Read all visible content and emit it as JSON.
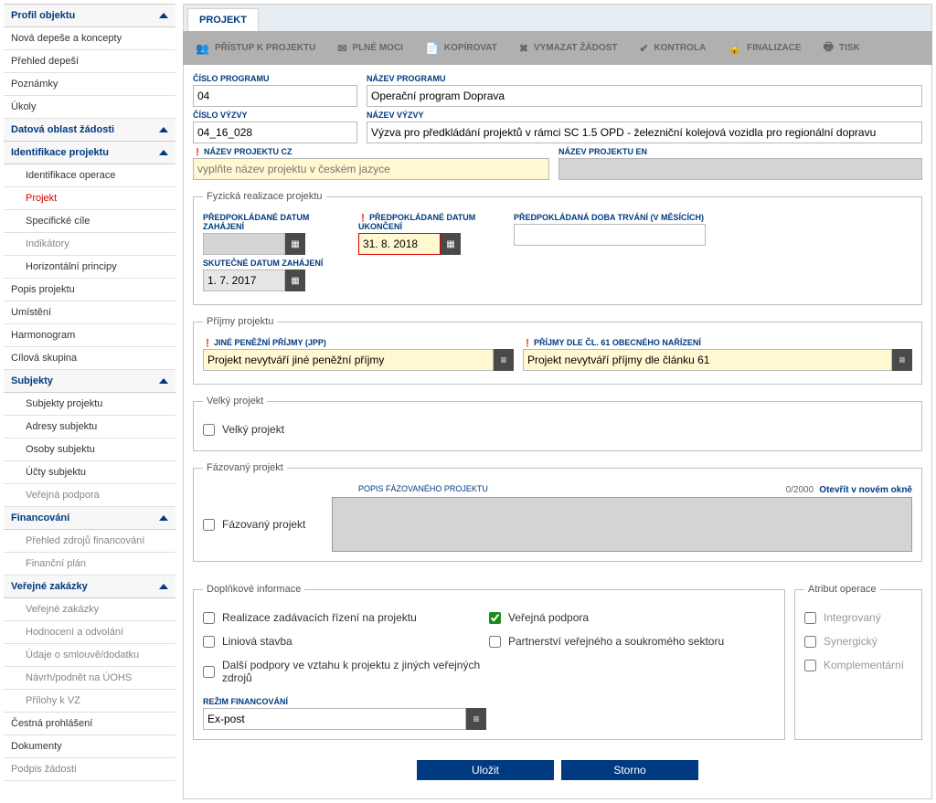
{
  "sidebar": {
    "groups": [
      {
        "label": "Profil objektu",
        "items": [
          {
            "label": "Nová depeše a koncepty"
          },
          {
            "label": "Přehled depeší"
          },
          {
            "label": "Poznámky"
          },
          {
            "label": "Úkoly"
          }
        ]
      },
      {
        "label": "Datová oblast žádosti",
        "items": []
      },
      {
        "label": "Identifikace projektu",
        "items": [
          {
            "label": "Identifikace operace",
            "sub": true
          },
          {
            "label": "Projekt",
            "sub": true,
            "active": true
          },
          {
            "label": "Specifické cíle",
            "sub": true
          },
          {
            "label": "Indikátory",
            "sub": true,
            "disabled": true
          },
          {
            "label": "Horizontální principy",
            "sub": true
          }
        ]
      },
      null,
      [
        {
          "label": "Popis projektu"
        },
        {
          "label": "Umístění"
        },
        {
          "label": "Harmonogram"
        },
        {
          "label": "Cílová skupina"
        }
      ],
      {
        "label": "Subjekty",
        "items": [
          {
            "label": "Subjekty projektu",
            "sub": true
          },
          {
            "label": "Adresy subjektu",
            "sub": true
          },
          {
            "label": "Osoby subjektu",
            "sub": true
          },
          {
            "label": "Účty subjektu",
            "sub": true
          },
          {
            "label": "Veřejná podpora",
            "sub": true,
            "disabled": true
          }
        ]
      },
      {
        "label": "Financování",
        "items": [
          {
            "label": "Přehled zdrojů financování",
            "sub": true,
            "disabled": true
          },
          {
            "label": "Finanční plán",
            "sub": true,
            "disabled": true
          }
        ]
      },
      {
        "label": "Veřejné zakázky",
        "items": [
          {
            "label": "Veřejné zakázky",
            "sub": true,
            "disabled": true
          },
          {
            "label": "Hodnocení a odvolání",
            "sub": true,
            "disabled": true
          },
          {
            "label": "Údaje o smlouvě/dodatku",
            "sub": true,
            "disabled": true
          },
          {
            "label": "Návrh/podnět na ÚOHS",
            "sub": true,
            "disabled": true
          },
          {
            "label": "Přílohy k VZ",
            "sub": true,
            "disabled": true
          }
        ]
      },
      null,
      [
        {
          "label": "Čestná prohlášení"
        },
        {
          "label": "Dokumenty"
        },
        {
          "label": "Podpis žádosti",
          "disabled": true
        }
      ]
    ]
  },
  "tabs": {
    "projekt": "PROJEKT"
  },
  "toolbar": {
    "pristup": "PŘÍSTUP K PROJEKTU",
    "plne_moci": "PLNÉ MOCI",
    "kopirovat": "KOPÍROVAT",
    "vymazat": "VYMAZAT ŽÁDOST",
    "kontrola": "KONTROLA",
    "finalizace": "FINALIZACE",
    "tisk": "TISK"
  },
  "fields": {
    "cislo_programu": {
      "label": "ČÍSLO PROGRAMU",
      "value": "04"
    },
    "nazev_programu": {
      "label": "NÁZEV PROGRAMU",
      "value": "Operační program Doprava"
    },
    "cislo_vyzvy": {
      "label": "ČÍSLO VÝZVY",
      "value": "04_16_028"
    },
    "nazev_vyzvy": {
      "label": "NÁZEV VÝZVY",
      "value": "Výzva pro předkládání projektů v rámci SC 1.5 OPD - železniční kolejová vozidla pro regionální dopravu"
    },
    "nazev_cz": {
      "label": "NÁZEV PROJEKTU CZ",
      "placeholder": "vyplňte název projektu v českém jazyce"
    },
    "nazev_en": {
      "label": "NÁZEV PROJEKTU EN"
    }
  },
  "fyzicka": {
    "legend": "Fyzická realizace projektu",
    "zahajeni": {
      "label": "PŘEDPOKLÁDANÉ DATUM ZAHÁJENÍ",
      "value": ""
    },
    "ukonceni": {
      "label": "PŘEDPOKLÁDANÉ DATUM UKONČENÍ",
      "value": "31. 8. 2018"
    },
    "trvani": {
      "label": "PŘEDPOKLÁDANÁ DOBA TRVÁNÍ (V MĚSÍCÍCH)",
      "value": ""
    },
    "skutecne": {
      "label": "SKUTEČNÉ DATUM ZAHÁJENÍ",
      "value": "1. 7. 2017"
    }
  },
  "prijmy": {
    "legend": "Příjmy projektu",
    "jpp": {
      "label": "JINÉ PENĚŽNÍ PŘÍJMY (JPP)",
      "value": "Projekt nevytváří jiné peněžní příjmy"
    },
    "cl61": {
      "label": "PŘÍJMY DLE ČL. 61 OBECNÉHO NAŘÍZENÍ",
      "value": "Projekt nevytváří příjmy dle článku 61"
    }
  },
  "velky": {
    "legend": "Velký projekt",
    "chk": "Velký projekt"
  },
  "fazovany": {
    "legend": "Fázovaný projekt",
    "chk": "Fázovaný projekt",
    "popis_label": "POPIS FÁZOVANÉHO PROJEKTU",
    "counter": "0/2000",
    "open": "Otevřít v novém okně"
  },
  "doplnkove": {
    "legend": "Doplňkové informace",
    "realizace": "Realizace zadávacích řízení na projektu",
    "verejna": "Veřejná podpora",
    "liniova": "Liniová stavba",
    "partnerstvi": "Partnerství veřejného a soukromého sektoru",
    "dalsi": "Další podpory ve vztahu k projektu z jiných veřejných zdrojů",
    "rezim_label": "REŽIM FINANCOVÁNÍ",
    "rezim_value": "Ex-post"
  },
  "atribut": {
    "legend": "Atribut operace",
    "integrovany": "Integrovaný",
    "synergicky": "Synergický",
    "komplementarni": "Komplementární"
  },
  "buttons": {
    "save": "Uložit",
    "cancel": "Storno"
  }
}
